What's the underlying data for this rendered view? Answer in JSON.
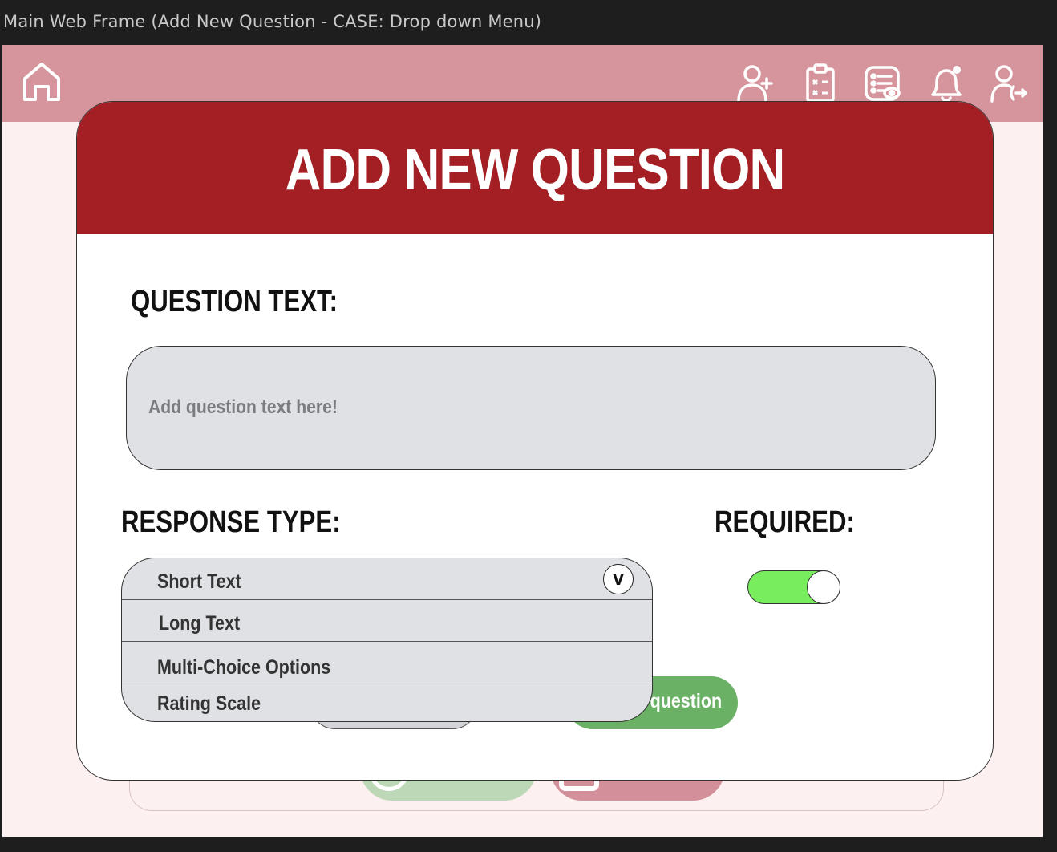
{
  "window": {
    "title": "Main Web Frame (Add New Question - CASE: Drop down Menu)"
  },
  "topbar": {
    "icons": [
      "home-icon",
      "add-user-icon",
      "checklist-icon",
      "view-form-icon",
      "notification-bell-icon",
      "logout-user-icon"
    ]
  },
  "modal": {
    "title": "ADD NEW QUESTION",
    "question_label": "QUESTION TEXT:",
    "question_placeholder": "Add question text here!",
    "response_label": "RESPONSE TYPE:",
    "required_label": "REQUIRED:",
    "required_on": true,
    "response_options": [
      "Short Text",
      "Long Text",
      "Multi-Choice Options",
      "Rating Scale"
    ],
    "add_button_label": "question"
  },
  "colors": {
    "topbar": "#d6959c",
    "header": "#a31f24",
    "toggle_on": "#78ee5e",
    "add_button": "#6ab165"
  }
}
